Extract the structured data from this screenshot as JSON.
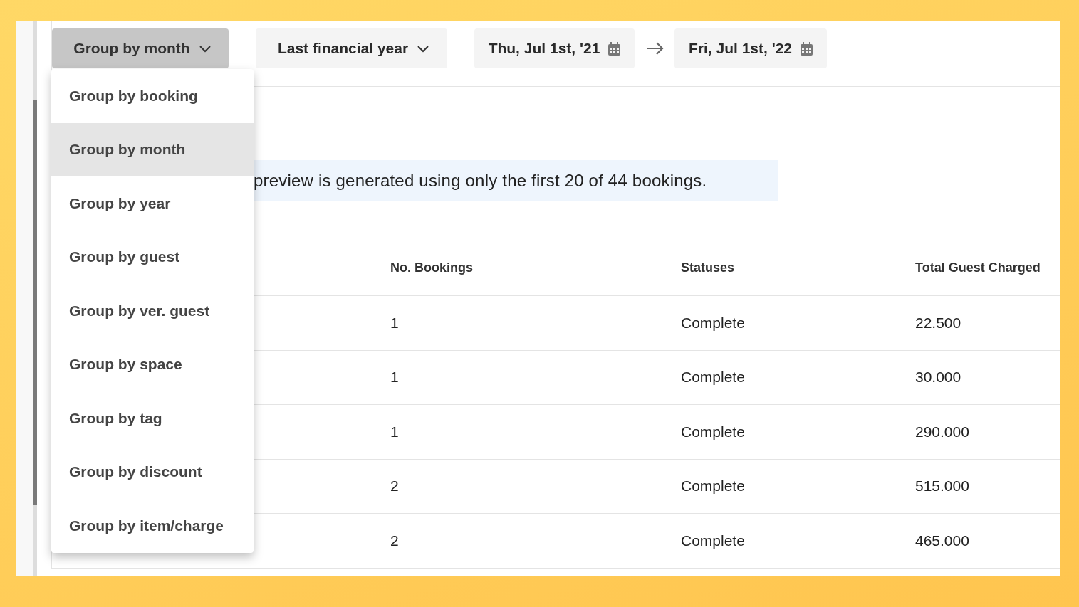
{
  "toolbar": {
    "group_by": {
      "label": "Group by month",
      "expanded": true
    },
    "period": {
      "label": "Last financial year"
    },
    "start_date": "Thu, Jul 1st, '21",
    "end_date": "Fri, Jul 1st, '22"
  },
  "group_menu": [
    {
      "label": "Group by booking",
      "selected": false
    },
    {
      "label": "Group by month",
      "selected": true
    },
    {
      "label": "Group by year",
      "selected": false
    },
    {
      "label": "Group by guest",
      "selected": false
    },
    {
      "label": "Group by ver. guest",
      "selected": false
    },
    {
      "label": "Group by space",
      "selected": false
    },
    {
      "label": "Group by tag",
      "selected": false
    },
    {
      "label": "Group by discount",
      "selected": false
    },
    {
      "label": "Group by item/charge",
      "selected": false
    }
  ],
  "banner": "preview is generated using only the first 20 of 44 bookings.",
  "table": {
    "columns": [
      "No. Bookings",
      "Statuses",
      "Total Guest Charged"
    ],
    "rows": [
      [
        "1",
        "Complete",
        "22.500"
      ],
      [
        "1",
        "Complete",
        "30.000"
      ],
      [
        "1",
        "Complete",
        "290.000"
      ],
      [
        "2",
        "Complete",
        "515.000"
      ],
      [
        "2",
        "Complete",
        "465.000"
      ]
    ]
  }
}
